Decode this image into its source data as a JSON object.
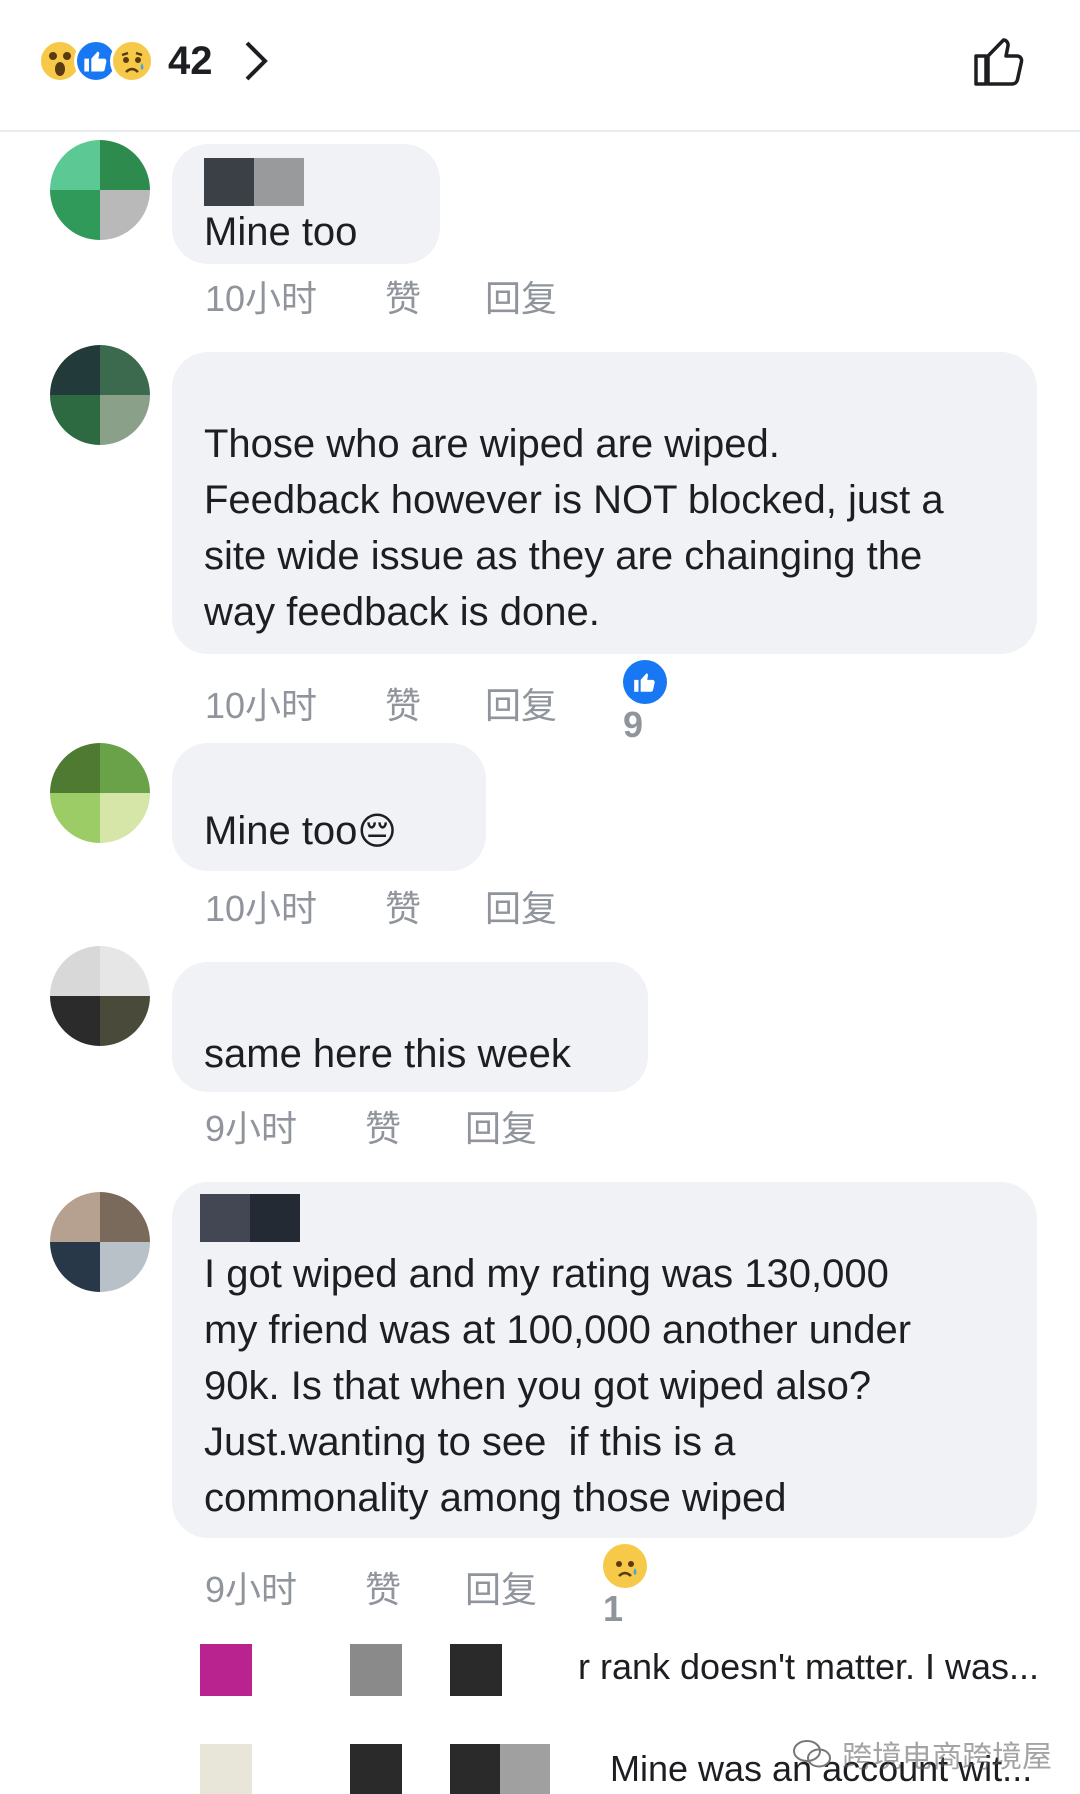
{
  "header": {
    "reaction_icons": [
      "wow-icon",
      "like-icon",
      "sad-icon"
    ],
    "reaction_count": "42"
  },
  "comments": [
    {
      "text": "Mine too",
      "time": "10小时",
      "like_label": "赞",
      "reply_label": "回复"
    },
    {
      "text": "Those who are wiped are wiped.\nFeedback however is NOT blocked, just a\nsite wide issue as they are chainging the\nway feedback is done.",
      "time": "10小时",
      "like_label": "赞",
      "reply_label": "回复",
      "reaction_icon": "like-icon",
      "reaction_count": "9"
    },
    {
      "text": "Mine too",
      "emoji": "😔",
      "time": "10小时",
      "like_label": "赞",
      "reply_label": "回复"
    },
    {
      "text": "same here this week",
      "time": "9小时",
      "like_label": "赞",
      "reply_label": "回复"
    },
    {
      "text": "I got wiped and my rating was 130,000\nmy friend was at 100,000 another under\n90k. Is that when you got wiped also?\nJust.wanting to see  if this is a\ncommonality among those wiped",
      "time": "9小时",
      "like_label": "赞",
      "reply_label": "回复",
      "reaction_icon": "sad-icon",
      "reaction_count": "1"
    }
  ],
  "replies": [
    {
      "text": "r rank doesn't matter. I was..."
    },
    {
      "text": "Mine was an account wit..."
    }
  ],
  "watermark": "跨境电商跨境屋",
  "colors": {
    "bubble": "#f0f2f5",
    "meta": "#90949c",
    "like_blue": "#1877f2",
    "emoji_yellow": "#f7c948"
  }
}
